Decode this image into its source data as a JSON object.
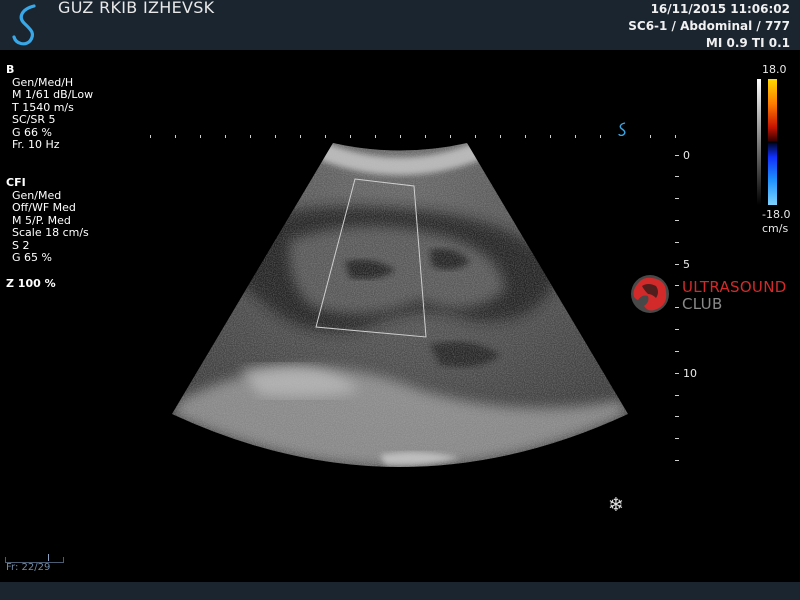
{
  "header": {
    "hospital": "GUZ RKIB IZHEVSK",
    "datetime": "16/11/2015 11:06:02",
    "probe_preset": "SC6-1 / Abdominal / 777",
    "indices": "MI 0.9  TI 0.1"
  },
  "b_mode": {
    "title": "B",
    "lines": [
      "Gen/Med/H",
      "M 1/61 dB/Low",
      "T 1540 m/s",
      "SC/SR 5",
      "G 66 %",
      "Fr. 10 Hz"
    ]
  },
  "cfi": {
    "title": "CFI",
    "lines": [
      "Gen/Med",
      "Off/WF Med",
      "M 5/P. Med",
      "Scale 18 cm/s",
      "S 2",
      "G 65 %"
    ]
  },
  "zoom": "Z  100  %",
  "depth_scale": {
    "labels": [
      "0",
      "5",
      "10"
    ]
  },
  "color_scale": {
    "max": "18.0",
    "min": "-18.0",
    "unit": "cm/s"
  },
  "watermark": {
    "line1": "ULTRASOUND",
    "line2": "CLUB"
  },
  "frame": "Fr: 22/29",
  "icons": {
    "logo": "company-s-logo",
    "freeze": "snowflake-icon",
    "orientation": "probe-orientation-icon"
  },
  "colors": {
    "header_bg": "#1b2530",
    "accent_blue": "#38a8e8",
    "watermark_red": "#d22a2a"
  }
}
